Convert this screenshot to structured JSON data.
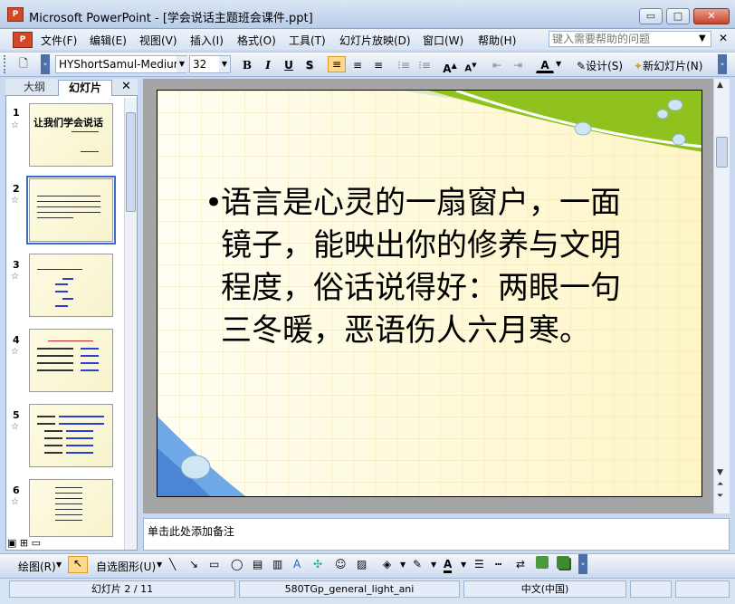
{
  "window": {
    "title": "Microsoft PowerPoint - [学会说话主题班会课件.ppt]",
    "app_icon_text": "P",
    "minimize": "▭",
    "maximize": "□",
    "close": "✕"
  },
  "menu": {
    "items": [
      "文件(F)",
      "编辑(E)",
      "视图(V)",
      "插入(I)",
      "格式(O)",
      "工具(T)",
      "幻灯片放映(D)",
      "窗口(W)",
      "帮助(H)"
    ],
    "help_placeholder": "键入需要帮助的问题",
    "close_doc": "✕"
  },
  "toolbar": {
    "font_name": "HYShortSamul-Medium",
    "font_size": "32",
    "bold": "B",
    "italic": "I",
    "underline": "U",
    "shadow": "S",
    "design_label": "设计(S)",
    "new_slide_label": "新幻灯片(N)"
  },
  "pane": {
    "tab_outline": "大纲",
    "tab_slides": "幻灯片",
    "close": "✕",
    "thumbnails": [
      {
        "num": "1",
        "title": "让我们学会说话",
        "selected": false
      },
      {
        "num": "2",
        "title": "",
        "selected": true
      },
      {
        "num": "3",
        "title": "",
        "selected": false
      },
      {
        "num": "4",
        "title": "",
        "selected": false
      },
      {
        "num": "5",
        "title": "",
        "selected": false
      },
      {
        "num": "6",
        "title": "",
        "selected": false
      }
    ]
  },
  "slide": {
    "bullet": "•",
    "text": "语言是心灵的一扇窗户，一面镜子，能映出你的修养与文明程度，俗话说得好：两眼一句三冬暖，恶语伤人六月寒。"
  },
  "notes": {
    "placeholder": "单击此处添加备注"
  },
  "drawbar": {
    "draw_label": "绘图(R)",
    "autoshapes_label": "自选图形(U)"
  },
  "status": {
    "slide_info": "幻灯片 2 / 11",
    "template": "580TGp_general_light_ani",
    "language": "中文(中国)"
  },
  "colors": {
    "accent_green": "#8fc21f",
    "slide_bg": "#fffbe0",
    "chrome": "#c9d9ef"
  }
}
